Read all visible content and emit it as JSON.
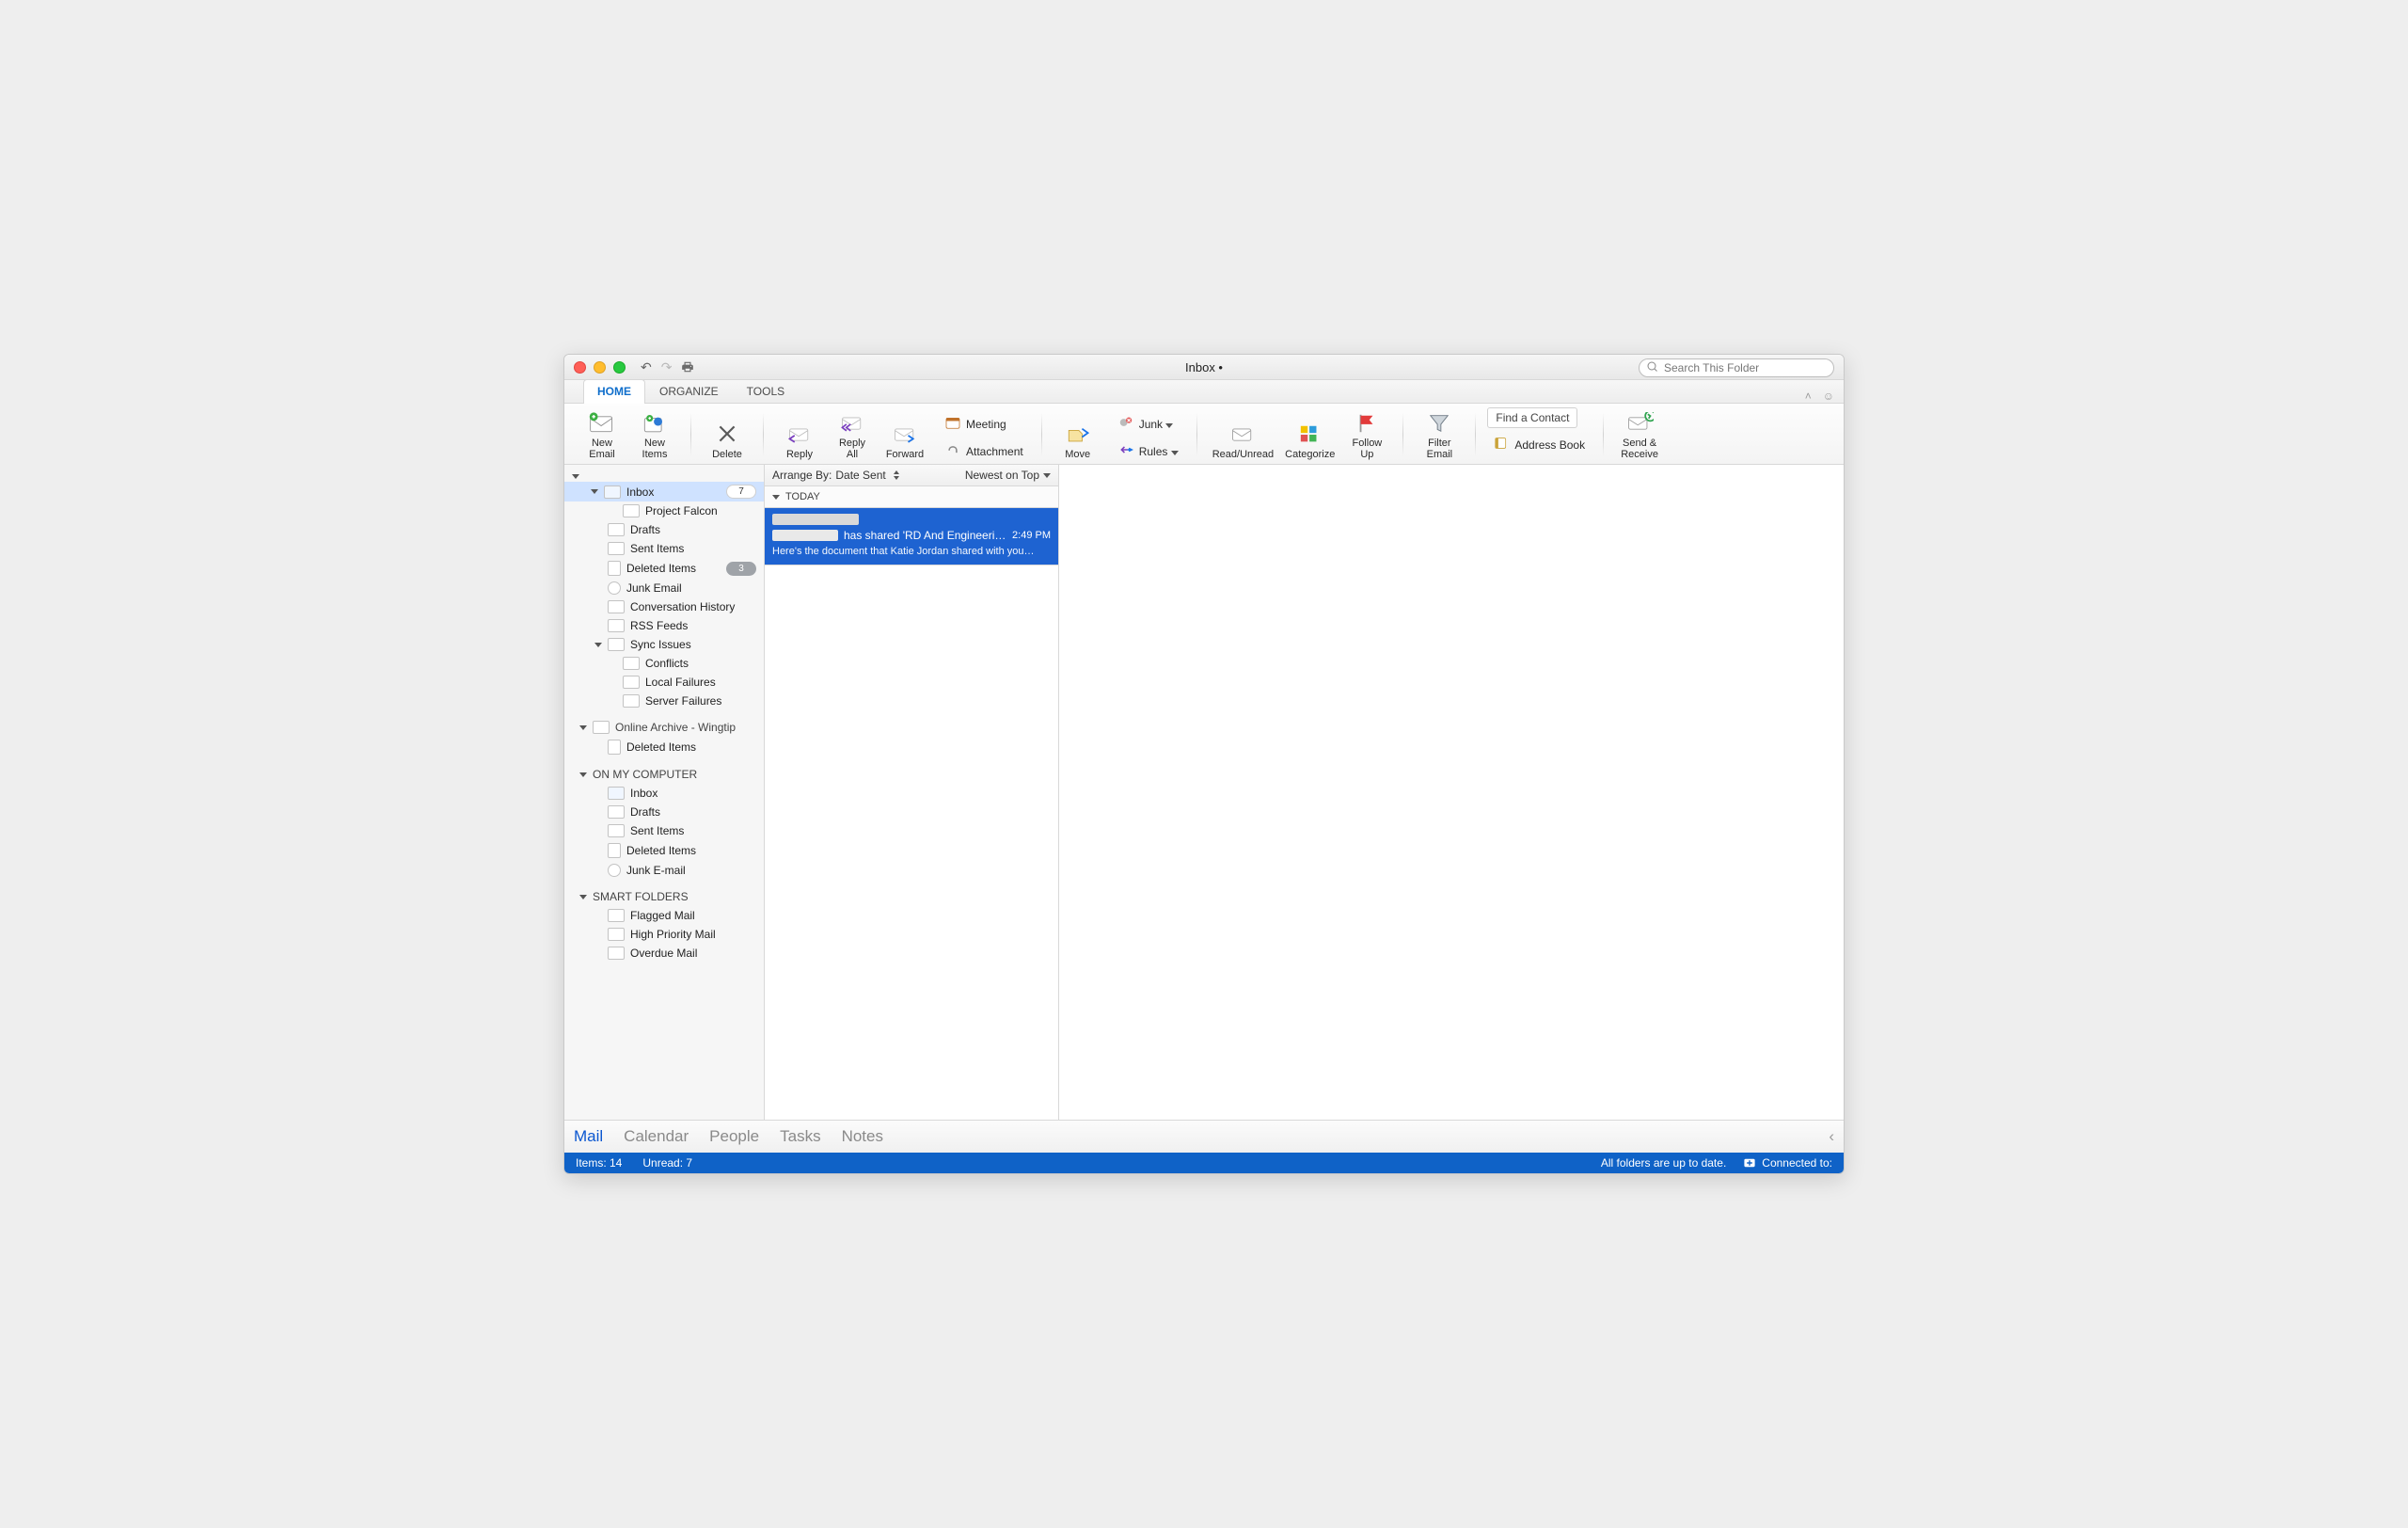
{
  "window": {
    "title": "Inbox •"
  },
  "search": {
    "placeholder": "Search This Folder"
  },
  "tabs": {
    "home": "HOME",
    "organize": "ORGANIZE",
    "tools": "TOOLS"
  },
  "ribbon": {
    "new_email": "New\nEmail",
    "new_items": "New\nItems",
    "delete": "Delete",
    "reply": "Reply",
    "reply_all": "Reply\nAll",
    "forward": "Forward",
    "meeting": "Meeting",
    "attachment": "Attachment",
    "move": "Move",
    "junk": "Junk",
    "rules": "Rules",
    "read_unread": "Read/Unread",
    "categorize": "Categorize",
    "follow_up": "Follow\nUp",
    "filter_email": "Filter\nEmail",
    "find_contact": "Find a Contact",
    "address_book": "Address Book",
    "send_receive": "Send &\nReceive"
  },
  "arrange": {
    "label": "Arrange By:",
    "field": "Date Sent",
    "order": "Newest on Top"
  },
  "dayhead": "TODAY",
  "message": {
    "subject": "has shared 'RD And Engineeri…",
    "time": "2:49 PM",
    "preview": "Here's the document that Katie Jordan shared with you…"
  },
  "folders": {
    "inbox": {
      "label": "Inbox",
      "count": "7"
    },
    "project_falcon": "Project Falcon",
    "drafts": "Drafts",
    "sent_items": "Sent Items",
    "deleted_items": {
      "label": "Deleted Items",
      "count": "3"
    },
    "junk_email": "Junk Email",
    "conversation_history": "Conversation History",
    "rss_feeds": "RSS Feeds",
    "sync_issues": "Sync Issues",
    "conflicts": "Conflicts",
    "local_failures": "Local Failures",
    "server_failures": "Server Failures",
    "online_archive": "Online Archive - Wingtip",
    "oa_deleted": "Deleted Items",
    "on_my_computer": "ON MY COMPUTER",
    "omc_inbox": "Inbox",
    "omc_drafts": "Drafts",
    "omc_sent": "Sent Items",
    "omc_deleted": "Deleted Items",
    "omc_junk": "Junk E-mail",
    "smart_folders": "SMART FOLDERS",
    "flagged": "Flagged Mail",
    "high_priority": "High Priority Mail",
    "overdue": "Overdue Mail"
  },
  "nav": {
    "mail": "Mail",
    "calendar": "Calendar",
    "people": "People",
    "tasks": "Tasks",
    "notes": "Notes"
  },
  "status": {
    "items": "Items: 14",
    "unread": "Unread: 7",
    "sync": "All folders are up to date.",
    "connected": "Connected to:"
  }
}
